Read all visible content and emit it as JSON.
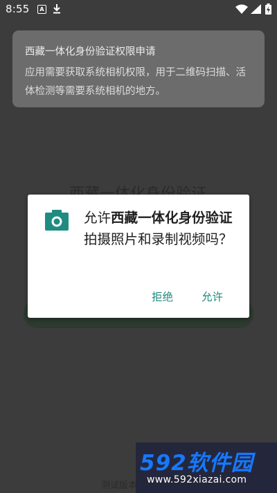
{
  "status_bar": {
    "time": "8:55",
    "notif_a_icon": "A",
    "icons": [
      "a-notification-icon",
      "download-icon",
      "wifi-icon",
      "signal-icon",
      "battery-charging-icon"
    ]
  },
  "permission_card": {
    "title": "西藏一体化身份验证权限申请",
    "description": "应用需要获取系统相机权限，用于二维码扫描、活体检测等需要系统相机的地方。"
  },
  "background": {
    "title": "西藏一体化身份验证",
    "footer": "测试版本"
  },
  "dialog": {
    "icon": "camera-icon",
    "msg_prefix": "允许",
    "app_name": "西藏一体化身份验证",
    "msg_suffix": "拍摄照片和录制视频吗？",
    "deny_label": "拒绝",
    "allow_label": "允许"
  },
  "watermark": {
    "logo": "592软件园",
    "url": "www.592xiazai.com"
  },
  "colors": {
    "accent": "#1e8a80",
    "overlay": "#3c3c3c",
    "watermark_blue": "#1678ff"
  }
}
